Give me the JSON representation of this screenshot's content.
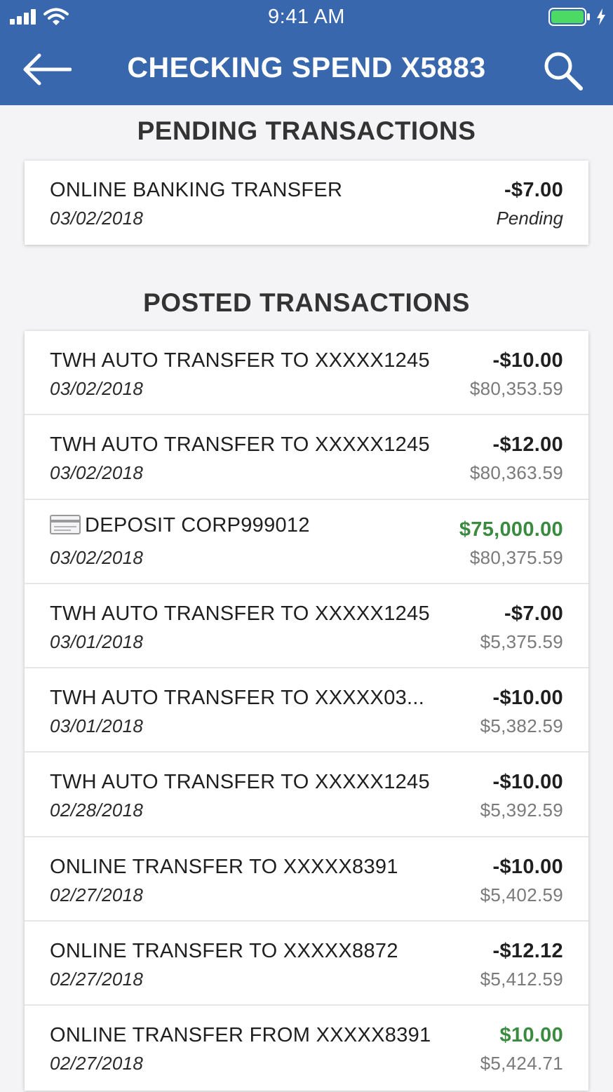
{
  "status_bar": {
    "time": "9:41 AM",
    "icons": [
      "signal-icon",
      "wifi-icon",
      "battery-icon",
      "charging-icon"
    ]
  },
  "nav": {
    "title": "CHECKING SPEND X5883",
    "back_icon": "arrow-left-icon",
    "search_icon": "search-icon"
  },
  "pending": {
    "section_title": "PENDING TRANSACTIONS",
    "items": [
      {
        "description": "ONLINE BANKING TRANSFER",
        "date": "03/02/2018",
        "amount": "-$7.00",
        "status": "Pending"
      }
    ]
  },
  "posted": {
    "section_title": "POSTED TRANSACTIONS",
    "items": [
      {
        "description": "TWH AUTO TRANSFER TO XXXXX1245",
        "date": "03/02/2018",
        "amount": "-$10.00",
        "balance": "$80,353.59"
      },
      {
        "description": "TWH AUTO TRANSFER TO XXXXX1245",
        "date": "03/02/2018",
        "amount": "-$12.00",
        "balance": "$80,363.59"
      },
      {
        "description": "DEPOSIT CORP999012",
        "date": "03/02/2018",
        "amount": "$75,000.00",
        "balance": "$80,375.59",
        "icon": "check-icon"
      },
      {
        "description": "TWH AUTO TRANSFER TO XXXXX1245",
        "date": "03/01/2018",
        "amount": "-$7.00",
        "balance": "$5,375.59"
      },
      {
        "description": "TWH AUTO TRANSFER TO XXXXX03...",
        "date": "03/01/2018",
        "amount": "-$10.00",
        "balance": "$5,382.59"
      },
      {
        "description": "TWH AUTO TRANSFER TO XXXXX1245",
        "date": "02/28/2018",
        "amount": "-$10.00",
        "balance": "$5,392.59"
      },
      {
        "description": "ONLINE TRANSFER TO XXXXX8391",
        "date": "02/27/2018",
        "amount": "-$10.00",
        "balance": "$5,402.59"
      },
      {
        "description": "ONLINE TRANSFER TO XXXXX8872",
        "date": "02/27/2018",
        "amount": "-$12.12",
        "balance": "$5,412.59"
      },
      {
        "description": "ONLINE TRANSFER FROM XXXXX8391",
        "date": "02/27/2018",
        "amount": "$10.00",
        "balance": "$5,424.71"
      }
    ]
  },
  "colors": {
    "header_bg": "#3867ad",
    "credit": "#3a8a40",
    "background": "#f4f4f6"
  }
}
